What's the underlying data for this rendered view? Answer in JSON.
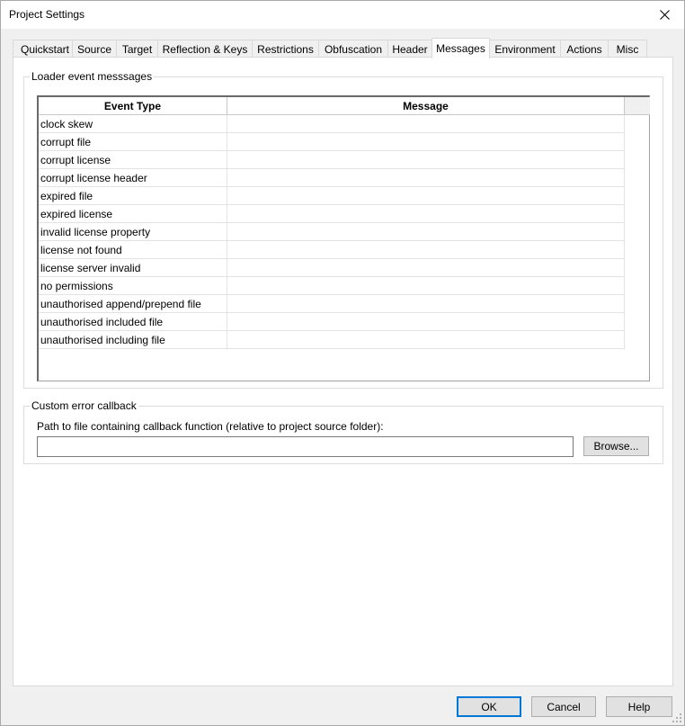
{
  "window": {
    "title": "Project Settings"
  },
  "tabs": [
    {
      "label": "Quickstart"
    },
    {
      "label": "Source"
    },
    {
      "label": "Target"
    },
    {
      "label": "Reflection & Keys"
    },
    {
      "label": "Restrictions"
    },
    {
      "label": "Obfuscation"
    },
    {
      "label": "Header"
    },
    {
      "label": "Messages",
      "active": true
    },
    {
      "label": "Environment"
    },
    {
      "label": "Actions"
    },
    {
      "label": "Misc"
    }
  ],
  "loader_group": {
    "title": "Loader event messsages",
    "columns": [
      "Event Type",
      "Message"
    ],
    "rows": [
      {
        "event": "clock skew",
        "message": ""
      },
      {
        "event": "corrupt file",
        "message": ""
      },
      {
        "event": "corrupt license",
        "message": ""
      },
      {
        "event": "corrupt license header",
        "message": ""
      },
      {
        "event": "expired file",
        "message": ""
      },
      {
        "event": "expired license",
        "message": ""
      },
      {
        "event": "invalid license property",
        "message": ""
      },
      {
        "event": "license not found",
        "message": ""
      },
      {
        "event": "license server invalid",
        "message": ""
      },
      {
        "event": "no permissions",
        "message": ""
      },
      {
        "event": "unauthorised append/prepend file",
        "message": ""
      },
      {
        "event": "unauthorised included file",
        "message": ""
      },
      {
        "event": "unauthorised including file",
        "message": ""
      }
    ]
  },
  "callback_group": {
    "title": "Custom error callback",
    "path_label": "Path to file containing callback function (relative to project source folder):",
    "path_value": "",
    "browse_label": "Browse..."
  },
  "footer": {
    "ok_label": "OK",
    "cancel_label": "Cancel",
    "help_label": "Help"
  },
  "colors": {
    "accent": "#0078d7",
    "window_bg": "#f0f0f0",
    "panel_bg": "#ffffff"
  }
}
